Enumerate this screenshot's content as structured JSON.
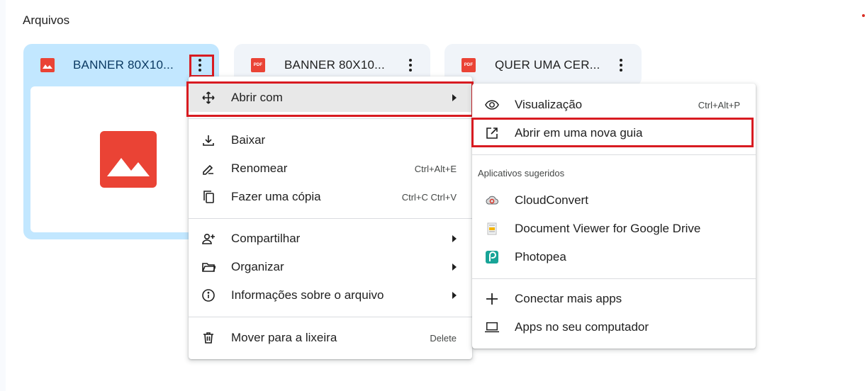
{
  "section": {
    "title": "Arquivos"
  },
  "files": [
    {
      "name": "BANNER 80X10...",
      "type_icon": "image-icon",
      "selected": true
    },
    {
      "name": "BANNER 80X10...",
      "type_icon": "pdf-icon",
      "type_label": "PDF"
    },
    {
      "name": "QUER UMA CER...",
      "type_icon": "pdf-icon",
      "type_label": "PDF"
    }
  ],
  "context_menu": {
    "items": [
      {
        "label": "Abrir com",
        "icon": "move-icon",
        "has_submenu": true,
        "highlighted": true
      },
      {
        "label": "Baixar",
        "icon": "download-icon"
      },
      {
        "label": "Renomear",
        "icon": "rename-icon",
        "shortcut": "Ctrl+Alt+E"
      },
      {
        "label": "Fazer uma cópia",
        "icon": "copy-icon",
        "shortcut": "Ctrl+C Ctrl+V"
      },
      {
        "label": "Compartilhar",
        "icon": "person-add-icon",
        "has_submenu": true
      },
      {
        "label": "Organizar",
        "icon": "folder-open-icon",
        "has_submenu": true
      },
      {
        "label": "Informações sobre o arquivo",
        "icon": "info-icon",
        "has_submenu": true
      },
      {
        "label": "Mover para a lixeira",
        "icon": "trash-icon",
        "shortcut": "Delete"
      }
    ]
  },
  "submenu": {
    "items": [
      {
        "label": "Visualização",
        "icon": "eye-icon",
        "shortcut": "Ctrl+Alt+P"
      },
      {
        "label": "Abrir em uma nova guia",
        "icon": "open-in-new-icon",
        "highlighted": true
      }
    ],
    "suggested_heading": "Aplicativos sugeridos",
    "apps": [
      {
        "label": "CloudConvert",
        "icon": "cloudconvert-icon"
      },
      {
        "label": "Document Viewer for Google Drive",
        "icon": "document-viewer-icon"
      },
      {
        "label": "Photopea",
        "icon": "photopea-icon"
      }
    ],
    "footer": [
      {
        "label": "Conectar mais apps",
        "icon": "plus-icon"
      },
      {
        "label": "Apps no seu computador",
        "icon": "laptop-icon"
      }
    ]
  },
  "colors": {
    "accent_red": "#d81b21",
    "selected_card": "#c2e7ff",
    "card": "#f0f4f9",
    "file_red": "#ea4335"
  }
}
